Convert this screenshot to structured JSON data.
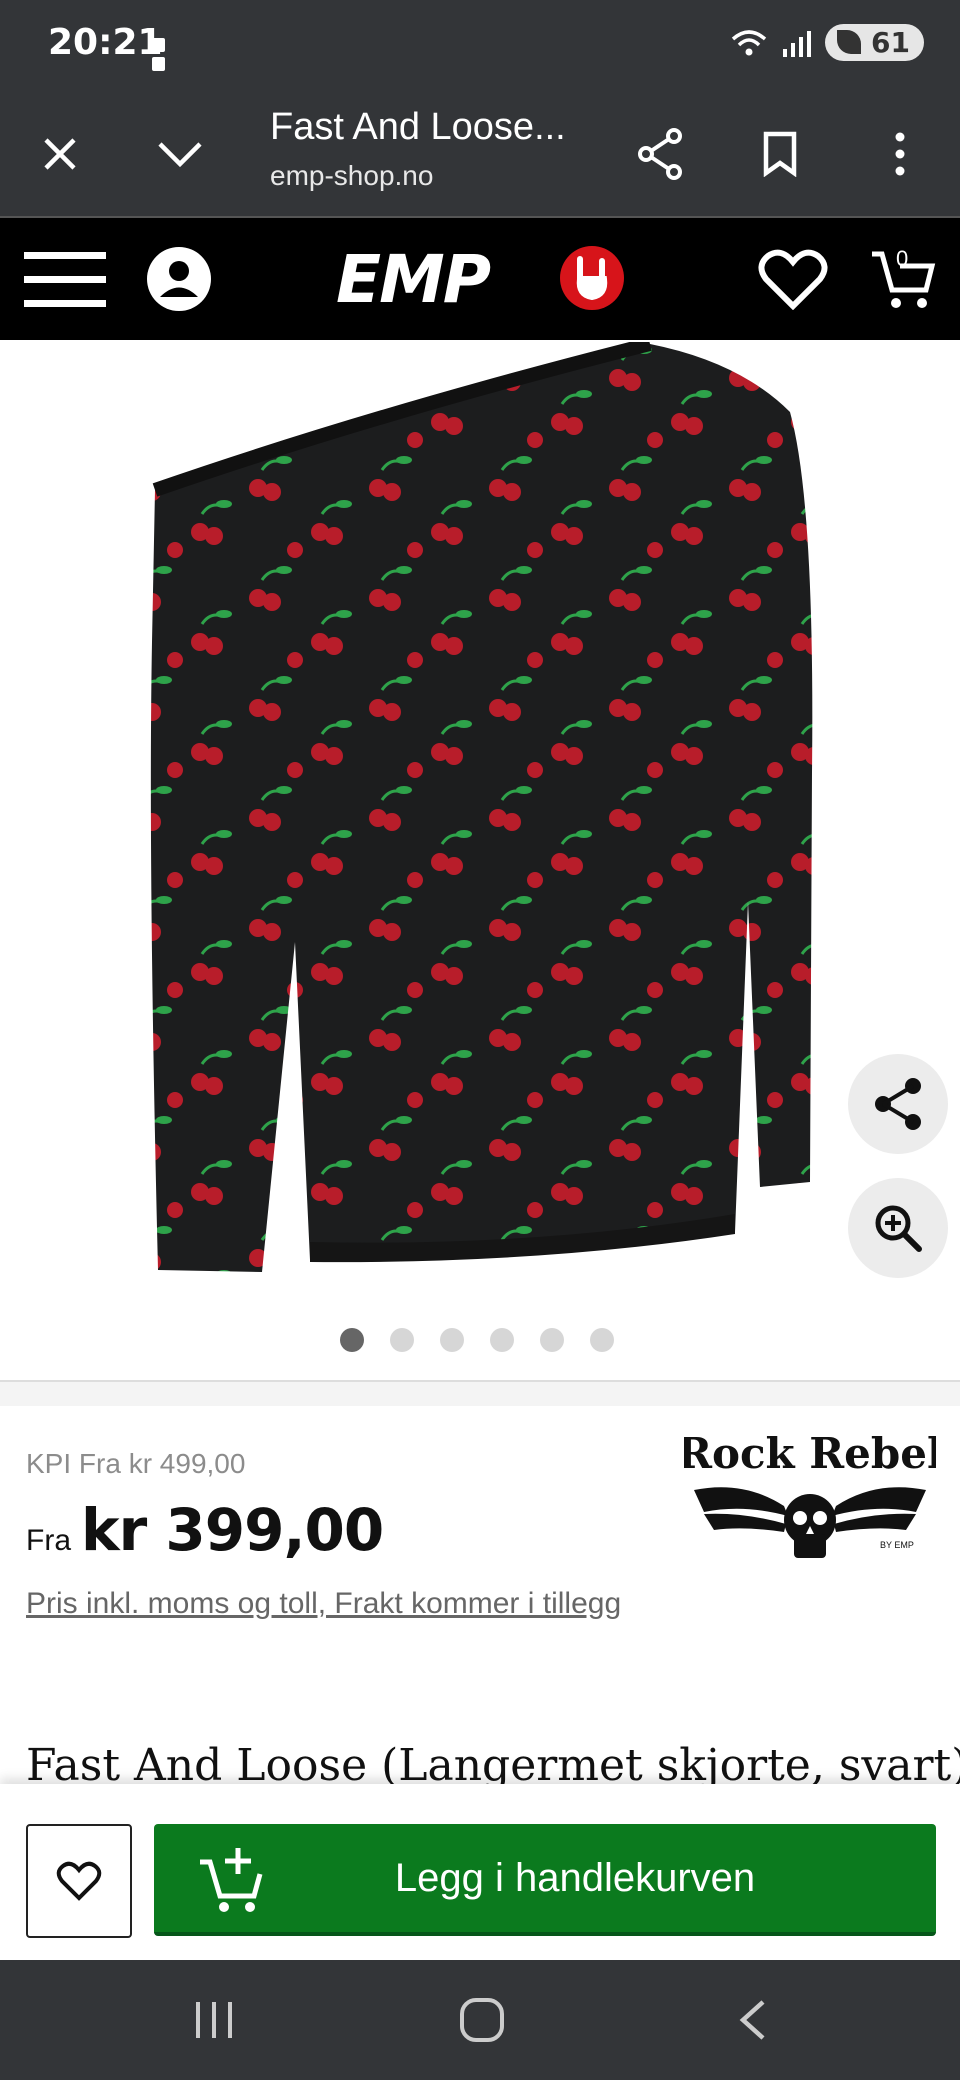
{
  "status_bar": {
    "time": "20:21",
    "battery": "61",
    "icons": [
      "wifi-icon",
      "signal-icon",
      "battery-saver-icon"
    ]
  },
  "browser": {
    "page_title": "Fast And Loose...",
    "url": "emp-shop.no",
    "icons": [
      "close-icon",
      "chevron-down-icon",
      "share-icon",
      "bookmark-icon",
      "more-vert-icon"
    ]
  },
  "shop_header": {
    "logo_text": "EMP",
    "cart_count": "0",
    "icons": [
      "menu-icon",
      "account-icon",
      "emp-logo",
      "heart-icon",
      "cart-icon"
    ]
  },
  "gallery": {
    "total_images": 6,
    "active_index": 0,
    "icons": [
      "share-icon",
      "zoom-in-icon"
    ]
  },
  "product": {
    "kpi_price": "KPI Fra kr 499,00",
    "price_prefix": "Fra",
    "price": "kr 399,00",
    "price_note": "Pris inkl. moms og toll, Frakt kommer i tillegg",
    "brand": "Rock Rebel",
    "brand_sub": "BY EMP",
    "title": "Fast And Loose (Langermet skjorte, svart)"
  },
  "actions": {
    "add_to_cart": "Legg i handlekurven"
  },
  "colors": {
    "header_bg": "#000000",
    "browser_bg": "#333538",
    "cart_button": "#0b7a1e",
    "emp_red": "#d7141a"
  }
}
